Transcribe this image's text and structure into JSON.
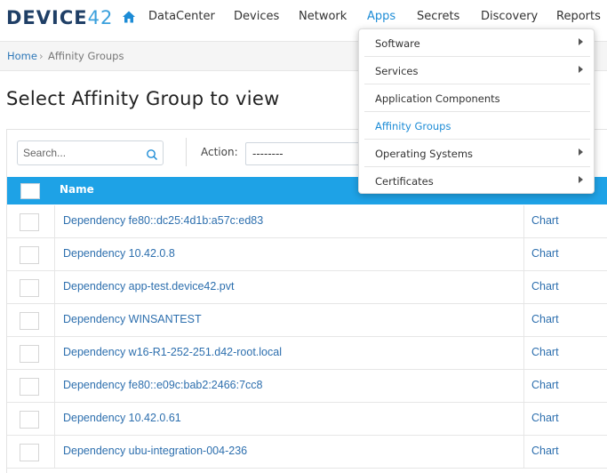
{
  "nav": {
    "logo_main": "DEVICE",
    "logo_num": "42",
    "items": [
      {
        "label": "DataCenter"
      },
      {
        "label": "Devices"
      },
      {
        "label": "Network"
      },
      {
        "label": "Apps"
      },
      {
        "label": "Secrets"
      },
      {
        "label": "Discovery"
      },
      {
        "label": "Reports"
      }
    ]
  },
  "breadcrumb": {
    "home": "Home",
    "sep": "›",
    "current": "Affinity Groups"
  },
  "page": {
    "title": "Select Affinity Group to view"
  },
  "toolbar": {
    "search_placeholder": "Search...",
    "action_label": "Action:",
    "action_value": "--------"
  },
  "table": {
    "header_name": "Name",
    "rows": [
      {
        "name": "Dependency fe80::dc25:4d1b:a57c:ed83",
        "chart": "Chart"
      },
      {
        "name": "Dependency 10.42.0.8",
        "chart": "Chart"
      },
      {
        "name": "Dependency app-test.device42.pvt",
        "chart": "Chart"
      },
      {
        "name": "Dependency WINSANTEST",
        "chart": "Chart"
      },
      {
        "name": "Dependency w16-R1-252-251.d42-root.local",
        "chart": "Chart"
      },
      {
        "name": "Dependency fe80::e09c:bab2:2466:7cc8",
        "chart": "Chart"
      },
      {
        "name": "Dependency 10.42.0.61",
        "chart": "Chart"
      },
      {
        "name": "Dependency ubu-integration-004-236",
        "chart": "Chart"
      }
    ]
  },
  "apps_menu": {
    "items": [
      {
        "label": "Software",
        "submenu": true
      },
      {
        "label": "Services",
        "submenu": true
      },
      {
        "label": "Application Components",
        "submenu": false
      },
      {
        "label": "Affinity Groups",
        "submenu": false,
        "active": true
      },
      {
        "label": "Operating Systems",
        "submenu": true
      },
      {
        "label": "Certificates",
        "submenu": true
      }
    ]
  },
  "colors": {
    "accent": "#1d8cd6",
    "header_bg": "#1ea2e6",
    "link": "#2d6fae",
    "logo": "#1f3f66"
  }
}
